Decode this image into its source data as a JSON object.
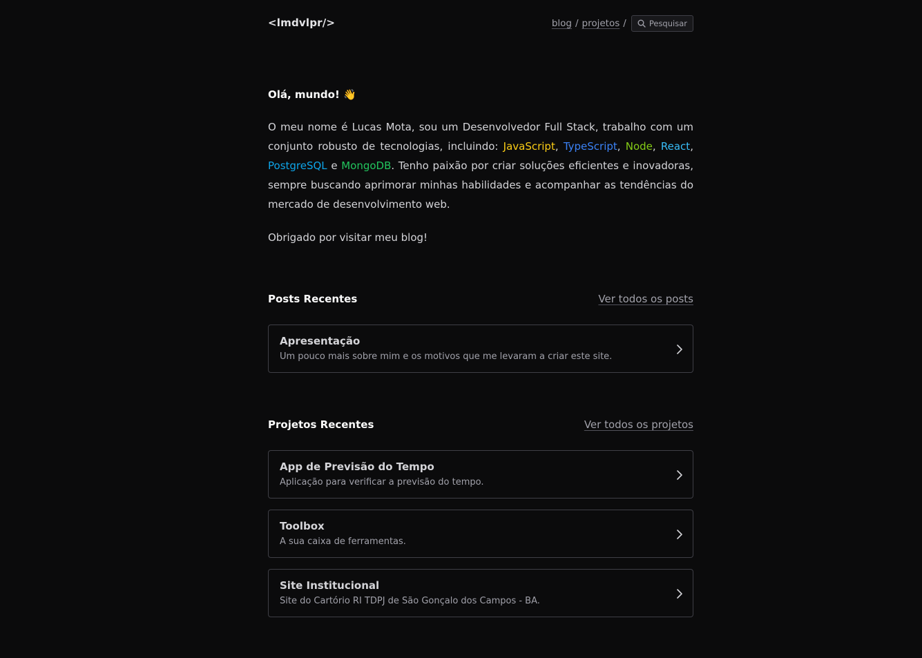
{
  "header": {
    "logo": "<lmdvlpr/>",
    "nav": {
      "blog": "blog",
      "projects": "projetos",
      "separator": "/",
      "search_label": "Pesquisar"
    }
  },
  "intro": {
    "greeting": "Olá, mundo! 👋",
    "bio_start": "O meu nome é Lucas Mota, sou um Desenvolvedor Full Stack, trabalho com um conjunto robusto de tecnologias, incluindo: ",
    "tech": {
      "javascript": "JavaScript",
      "typescript": "TypeScript",
      "node": "Node",
      "react": "React",
      "postgresql": "PostgreSQL",
      "mongodb": "MongoDB"
    },
    "comma": ",",
    "and": "e",
    "bio_end": ". Tenho paixão por criar soluções eficientes e inovadoras, sempre buscando aprimorar minhas habilidades e acompanhar as tendências do mercado de desenvolvimento web.",
    "thanks": "Obrigado por visitar meu blog!"
  },
  "posts": {
    "title": "Posts Recentes",
    "view_all": "Ver todos os posts",
    "items": [
      {
        "title": "Apresentação",
        "description": "Um pouco mais sobre mim e os motivos que me levaram a criar este site."
      }
    ]
  },
  "projects": {
    "title": "Projetos Recentes",
    "view_all": "Ver todos os projetos",
    "items": [
      {
        "title": "App de Previsão do Tempo",
        "description": "Aplicação para verificar a previsão do tempo."
      },
      {
        "title": "Toolbox",
        "description": "A sua caixa de ferramentas."
      },
      {
        "title": "Site Institucional",
        "description": "Site do Cartório RI TDPJ de São Gonçalo dos Campos - BA."
      }
    ]
  },
  "colors": {
    "background": "#0b0b0c",
    "javascript": "#facc15",
    "typescript": "#3b82f6",
    "node": "#84cc16",
    "react": "#38bdf8",
    "postgresql": "#0ea5e9",
    "mongodb": "#22c55e"
  },
  "icons": {
    "search": "search-icon",
    "card_arrow": "chevron-right-icon"
  }
}
